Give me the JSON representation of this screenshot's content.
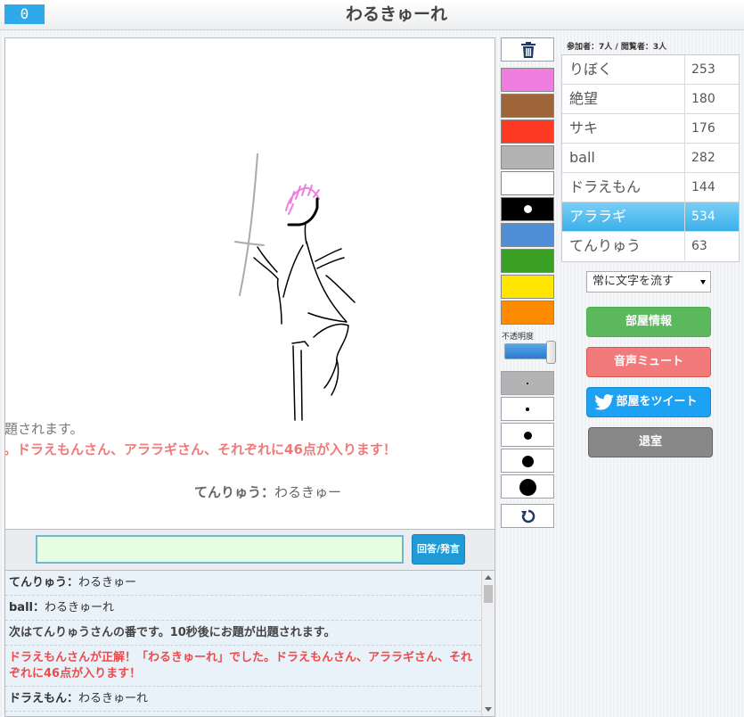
{
  "header": {
    "score": "0",
    "title": "わるきゅーれ"
  },
  "canvas": {
    "messages": {
      "line1": "題されます。",
      "line2": "。ドラえもんさん、アララギさん、それぞれに46点が入ります！",
      "line3_name": "てんりゅう：",
      "line3_text": "わるきゅー"
    }
  },
  "answer": {
    "value": "",
    "button_label": "回答/発言"
  },
  "chat": [
    {
      "type": "user",
      "name": "てんりゅう：",
      "text": "わるきゅー"
    },
    {
      "type": "user",
      "name": "ball：",
      "text": "わるきゅーれ"
    },
    {
      "type": "sys",
      "text": "次はてんりゅうさんの番です。10秒後にお題が出題されます。"
    },
    {
      "type": "correct",
      "text": "ドラえもんさんが正解！「わるきゅーれ」でした。ドラえもんさん、アララギさん、それぞれに46点が入ります！"
    },
    {
      "type": "user",
      "name": "ドラえもん：",
      "text": "わるきゅーれ"
    }
  ],
  "tools": {
    "colors": [
      "#f07ee0",
      "#9f6438",
      "#ff3a24",
      "#b3b3b3",
      "#ffffff",
      "#000000",
      "#4e8fd8",
      "#3aa023",
      "#ffe600",
      "#ff8c00"
    ],
    "selected_color_index": 5,
    "opacity_label": "不透明度",
    "opacity_value": 1.0,
    "brush_sizes": [
      2,
      4,
      9,
      13,
      19
    ],
    "selected_size_index": 0
  },
  "participants": {
    "label": "参加者：7人 / 閲覧者：3人"
  },
  "scoreboard": [
    {
      "name": "りぼく",
      "points": "253",
      "active": false
    },
    {
      "name": "絶望",
      "points": "180",
      "active": false
    },
    {
      "name": "サキ",
      "points": "176",
      "active": false
    },
    {
      "name": "ball",
      "points": "282",
      "active": false
    },
    {
      "name": "ドラえもん",
      "points": "144",
      "active": false
    },
    {
      "name": "アララギ",
      "points": "534",
      "active": true
    },
    {
      "name": "てんりゅう",
      "points": "63",
      "active": false
    }
  ],
  "controls": {
    "scroll_select": "常に文字を流す",
    "room_info": "部屋情報",
    "mute": "音声ミュート",
    "tweet": "部屋をツイート",
    "leave": "退室"
  }
}
